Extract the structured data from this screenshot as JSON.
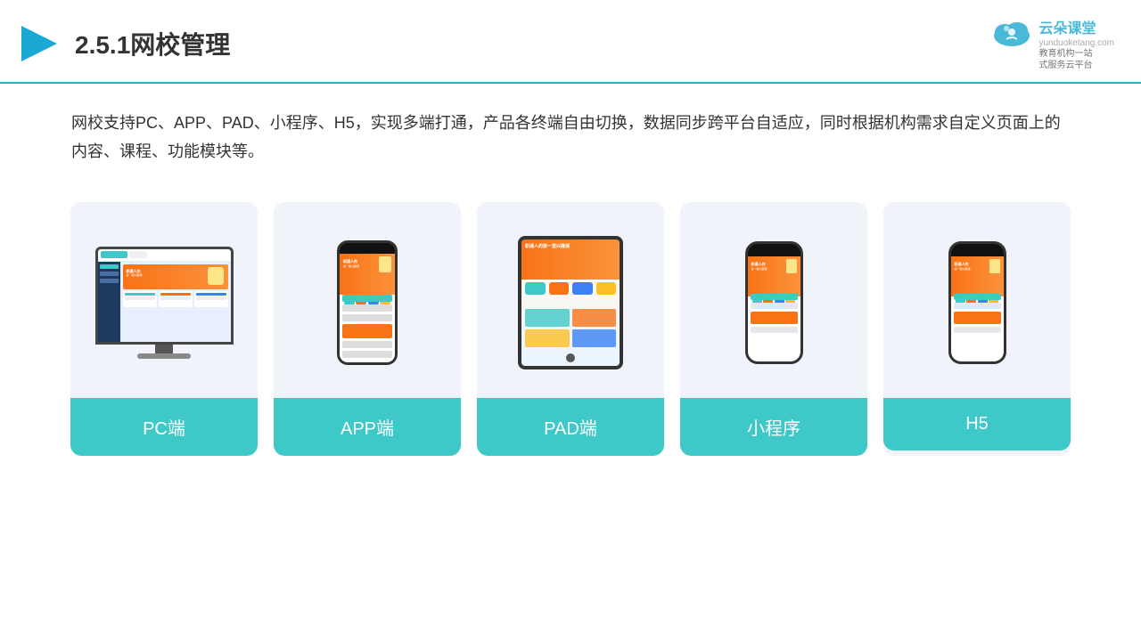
{
  "header": {
    "title": "2.5.1网校管理",
    "logo_name": "云朵课堂",
    "logo_url": "yunduoketang.com",
    "logo_slogan": "教育机构一站\n式服务云平台"
  },
  "description": {
    "text": "网校支持PC、APP、PAD、小程序、H5，实现多端打通，产品各终端自由切换，数据同步跨平台自适应，同时根据机构需求自定义页面上的内容、课程、功能模块等。"
  },
  "cards": [
    {
      "id": "pc",
      "label": "PC端"
    },
    {
      "id": "app",
      "label": "APP端"
    },
    {
      "id": "pad",
      "label": "PAD端"
    },
    {
      "id": "miniprogram",
      "label": "小程序"
    },
    {
      "id": "h5",
      "label": "H5"
    }
  ],
  "colors": {
    "accent": "#3ec8c8",
    "header_border": "#1db8c8",
    "card_bg": "#f0f4fa",
    "text_primary": "#333333",
    "text_secondary": "#666666"
  }
}
